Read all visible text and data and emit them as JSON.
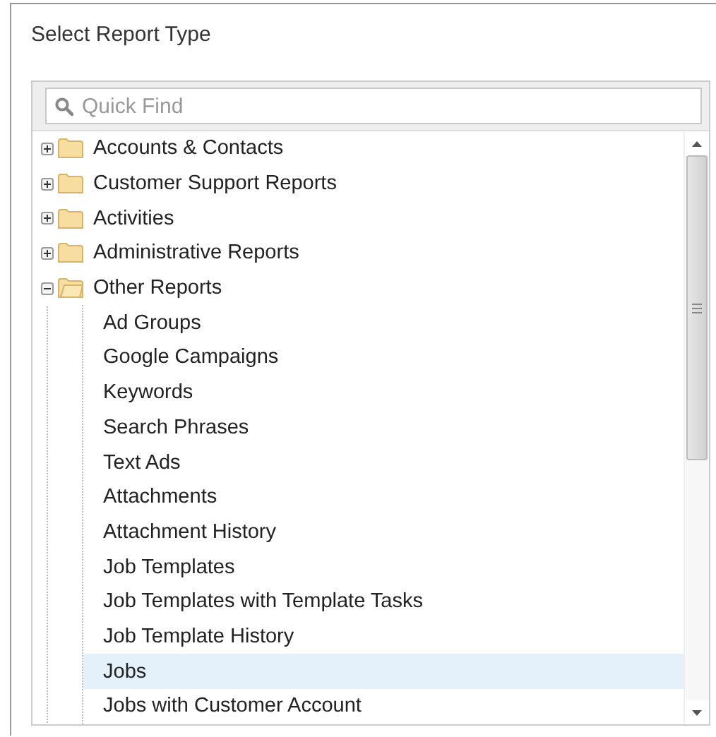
{
  "title": "Select Report Type",
  "search": {
    "placeholder": "Quick Find"
  },
  "tree": [
    {
      "label": "Accounts & Contacts",
      "expanded": false,
      "selected": false
    },
    {
      "label": "Customer Support Reports",
      "expanded": false,
      "selected": false
    },
    {
      "label": "Activities",
      "expanded": false,
      "selected": false
    },
    {
      "label": "Administrative Reports",
      "expanded": false,
      "selected": false
    },
    {
      "label": "Other Reports",
      "expanded": true,
      "selected": false,
      "children": [
        {
          "label": "Ad Groups",
          "selected": false
        },
        {
          "label": "Google Campaigns",
          "selected": false
        },
        {
          "label": "Keywords",
          "selected": false
        },
        {
          "label": "Search Phrases",
          "selected": false
        },
        {
          "label": "Text Ads",
          "selected": false
        },
        {
          "label": "Attachments",
          "selected": false
        },
        {
          "label": "Attachment History",
          "selected": false
        },
        {
          "label": "Job Templates",
          "selected": false
        },
        {
          "label": "Job Templates with Template Tasks",
          "selected": false
        },
        {
          "label": "Job Template History",
          "selected": false
        },
        {
          "label": "Jobs",
          "selected": true
        },
        {
          "label": "Jobs with Customer Account",
          "selected": false
        }
      ]
    }
  ]
}
